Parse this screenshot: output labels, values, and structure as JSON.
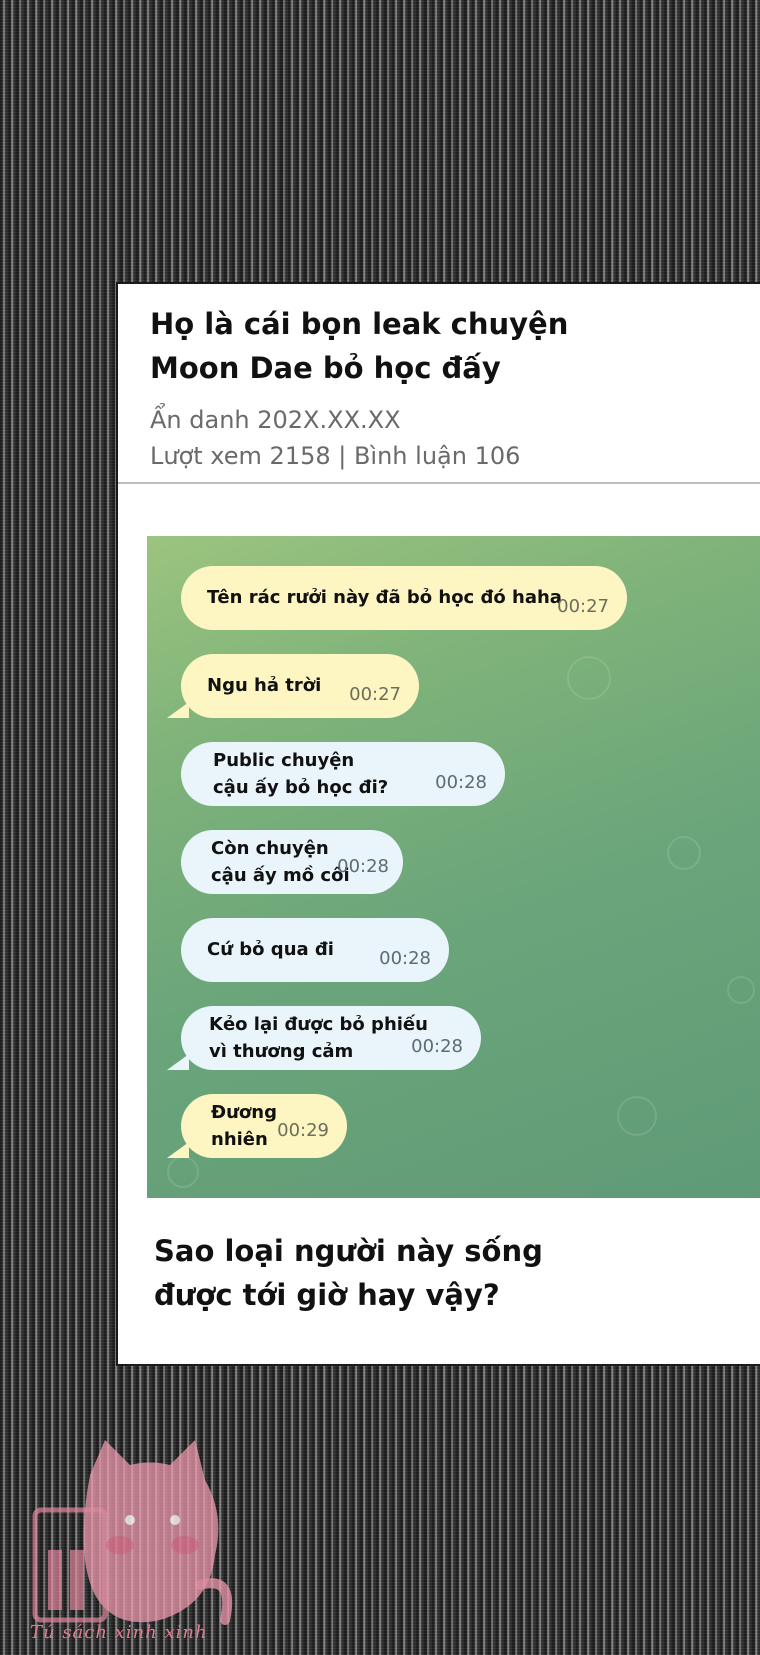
{
  "post": {
    "title_line1": "Họ là cái bọn leak chuyện",
    "title_line2": "Moon Dae bỏ học đấy",
    "author_date": "Ẩn danh 202X.XX.XX",
    "stats": "Lượt xem 2158 | Bình luận 106"
  },
  "chat": {
    "messages": [
      {
        "lines": [
          "Tên rác rưởi này đã bỏ học đó haha"
        ],
        "time": "00:27",
        "color": "#fdf6c3"
      },
      {
        "lines": [
          "Ngu hả trời"
        ],
        "time": "00:27",
        "color": "#fdf6c3"
      },
      {
        "lines": [
          "Public chuyện",
          "cậu ấy bỏ học đi?"
        ],
        "time": "00:28",
        "color": "#e9f4fb"
      },
      {
        "lines": [
          "Còn chuyện",
          "cậu ấy mồ côi"
        ],
        "time": "00:28",
        "color": "#e9f4fb"
      },
      {
        "lines": [
          "Cứ bỏ qua đi"
        ],
        "time": "00:28",
        "color": "#e9f4fb"
      },
      {
        "lines": [
          "Kẻo lại được bỏ phiếu",
          "vì thương cảm"
        ],
        "time": "00:28",
        "color": "#e9f4fb"
      },
      {
        "lines": [
          "Đương",
          "nhiên"
        ],
        "time": "00:29",
        "color": "#fdf6c3"
      }
    ]
  },
  "footer": {
    "line1": "Sao loại người này sống",
    "line2": "được tới giờ hay vậy?"
  },
  "watermark": {
    "text": "Tú sách xinh xinh",
    "icon": "pink-cat-logo"
  }
}
